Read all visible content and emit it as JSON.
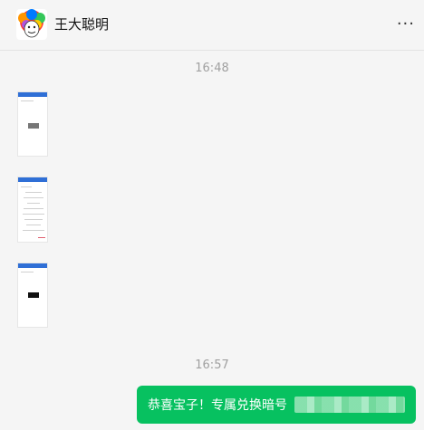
{
  "header": {
    "contact_name": "王大聪明",
    "more_label": "···"
  },
  "messages": [
    {
      "type": "timestamp",
      "text": "16:48"
    },
    {
      "type": "image",
      "name": "screenshot-1"
    },
    {
      "type": "image",
      "name": "screenshot-2"
    },
    {
      "type": "image",
      "name": "screenshot-3"
    },
    {
      "type": "timestamp",
      "text": "16:57"
    },
    {
      "type": "text",
      "sender": "self",
      "text": "恭喜宝子！专属兑换暗号"
    }
  ],
  "colors": {
    "bubble_self": "#07c160",
    "background": "#f5f5f5",
    "thumb_header": "#2f6fd6"
  }
}
